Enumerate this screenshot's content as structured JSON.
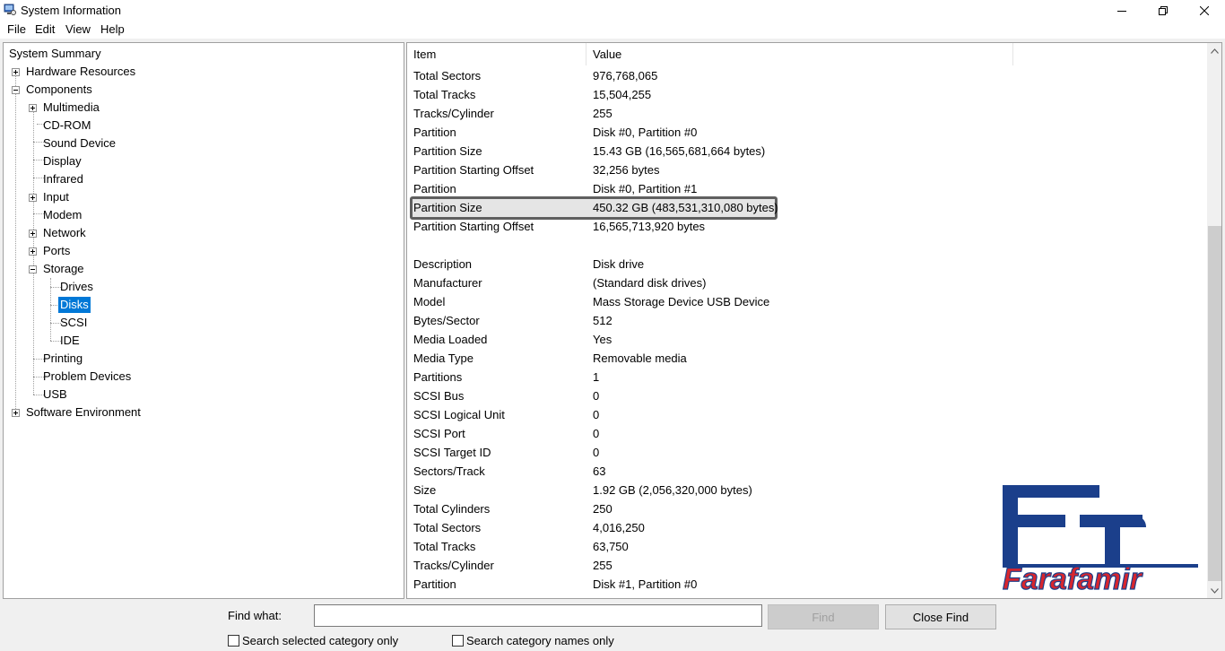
{
  "window": {
    "title": "System Information",
    "app_icon": "system-info-icon",
    "controls": [
      "minimize-icon",
      "restore-icon",
      "close-icon"
    ]
  },
  "menu": [
    "File",
    "Edit",
    "View",
    "Help"
  ],
  "tree": {
    "items": [
      {
        "label": "System Summary",
        "level": 0,
        "expander": "none"
      },
      {
        "label": "Hardware Resources",
        "level": 1,
        "expander": "plus"
      },
      {
        "label": "Components",
        "level": 1,
        "expander": "minus"
      },
      {
        "label": "Multimedia",
        "level": 2,
        "expander": "plus"
      },
      {
        "label": "CD-ROM",
        "level": 2,
        "expander": "none"
      },
      {
        "label": "Sound Device",
        "level": 2,
        "expander": "none"
      },
      {
        "label": "Display",
        "level": 2,
        "expander": "none"
      },
      {
        "label": "Infrared",
        "level": 2,
        "expander": "none"
      },
      {
        "label": "Input",
        "level": 2,
        "expander": "plus"
      },
      {
        "label": "Modem",
        "level": 2,
        "expander": "none"
      },
      {
        "label": "Network",
        "level": 2,
        "expander": "plus"
      },
      {
        "label": "Ports",
        "level": 2,
        "expander": "plus"
      },
      {
        "label": "Storage",
        "level": 2,
        "expander": "minus"
      },
      {
        "label": "Drives",
        "level": 3,
        "expander": "none"
      },
      {
        "label": "Disks",
        "level": 3,
        "expander": "none",
        "selected": true
      },
      {
        "label": "SCSI",
        "level": 3,
        "expander": "none"
      },
      {
        "label": "IDE",
        "level": 3,
        "expander": "none"
      },
      {
        "label": "Printing",
        "level": 2,
        "expander": "none"
      },
      {
        "label": "Problem Devices",
        "level": 2,
        "expander": "none"
      },
      {
        "label": "USB",
        "level": 2,
        "expander": "none"
      },
      {
        "label": "Software Environment",
        "level": 1,
        "expander": "plus"
      }
    ]
  },
  "table": {
    "headers": {
      "item": "Item",
      "value": "Value"
    },
    "rows": [
      {
        "item": "Total Sectors",
        "value": "976,768,065"
      },
      {
        "item": "Total Tracks",
        "value": "15,504,255"
      },
      {
        "item": "Tracks/Cylinder",
        "value": "255"
      },
      {
        "item": "Partition",
        "value": "Disk #0, Partition #0"
      },
      {
        "item": "Partition Size",
        "value": "15.43 GB (16,565,681,664 bytes)"
      },
      {
        "item": "Partition Starting Offset",
        "value": "32,256 bytes"
      },
      {
        "item": "Partition",
        "value": "Disk #0, Partition #1"
      },
      {
        "item": "Partition Size",
        "value": "450.32 GB (483,531,310,080 bytes)",
        "highlighted": true
      },
      {
        "item": "Partition Starting Offset",
        "value": "16,565,713,920 bytes"
      },
      {
        "item": "",
        "value": ""
      },
      {
        "item": "Description",
        "value": "Disk drive"
      },
      {
        "item": "Manufacturer",
        "value": "(Standard disk drives)"
      },
      {
        "item": "Model",
        "value": "Mass Storage Device USB Device"
      },
      {
        "item": "Bytes/Sector",
        "value": "512"
      },
      {
        "item": "Media Loaded",
        "value": "Yes"
      },
      {
        "item": "Media Type",
        "value": "Removable media"
      },
      {
        "item": "Partitions",
        "value": "1"
      },
      {
        "item": "SCSI Bus",
        "value": "0"
      },
      {
        "item": "SCSI Logical Unit",
        "value": "0"
      },
      {
        "item": "SCSI Port",
        "value": "0"
      },
      {
        "item": "SCSI Target ID",
        "value": "0"
      },
      {
        "item": "Sectors/Track",
        "value": "63"
      },
      {
        "item": "Size",
        "value": "1.92 GB (2,056,320,000 bytes)"
      },
      {
        "item": "Total Cylinders",
        "value": "250"
      },
      {
        "item": "Total Sectors",
        "value": "4,016,250"
      },
      {
        "item": "Total Tracks",
        "value": "63,750"
      },
      {
        "item": "Tracks/Cylinder",
        "value": "255"
      },
      {
        "item": "Partition",
        "value": "Disk #1, Partition #0"
      }
    ]
  },
  "logo": {
    "text": "Farafamir",
    "colors": {
      "blue": "#1b3f8b",
      "red": "#d7262e"
    }
  },
  "find_bar": {
    "find_what_label": "Find what:",
    "find_value": "",
    "find_button": "Find",
    "close_find_button": "Close Find",
    "checkbox_selected_category": "Search selected category only",
    "checkbox_category_names": "Search category names only"
  },
  "colors": {
    "selection": "#0078d7",
    "highlight_border": "#5f5f5f"
  }
}
